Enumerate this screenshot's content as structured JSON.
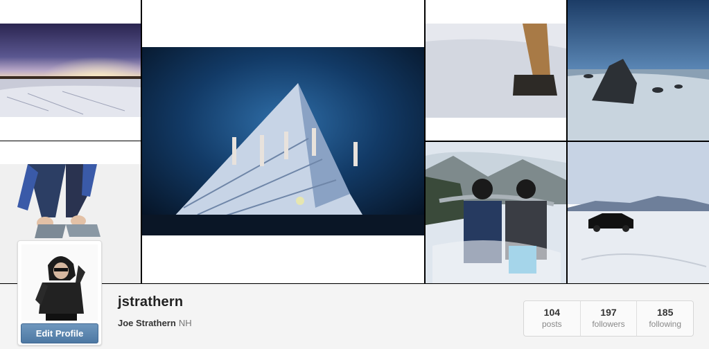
{
  "profile": {
    "username": "jstrathern",
    "full_name": "Joe Strathern",
    "location": "NH",
    "edit_label": "Edit Profile"
  },
  "stats": [
    {
      "count": "104",
      "label": "posts"
    },
    {
      "count": "197",
      "label": "followers"
    },
    {
      "count": "185",
      "label": "following"
    }
  ],
  "grid": {
    "photos": [
      "night-sky-snow-photo",
      "shoes-tying-photo",
      "concert-pyramid-stage-photo",
      "boots-in-snow-photo",
      "rock-in-water-photo",
      "ski-lift-selfie-photo",
      "car-on-frozen-lake-photo"
    ]
  },
  "colors": {
    "button": "#4d78a3",
    "footer_bg": "#f4f4f4"
  }
}
